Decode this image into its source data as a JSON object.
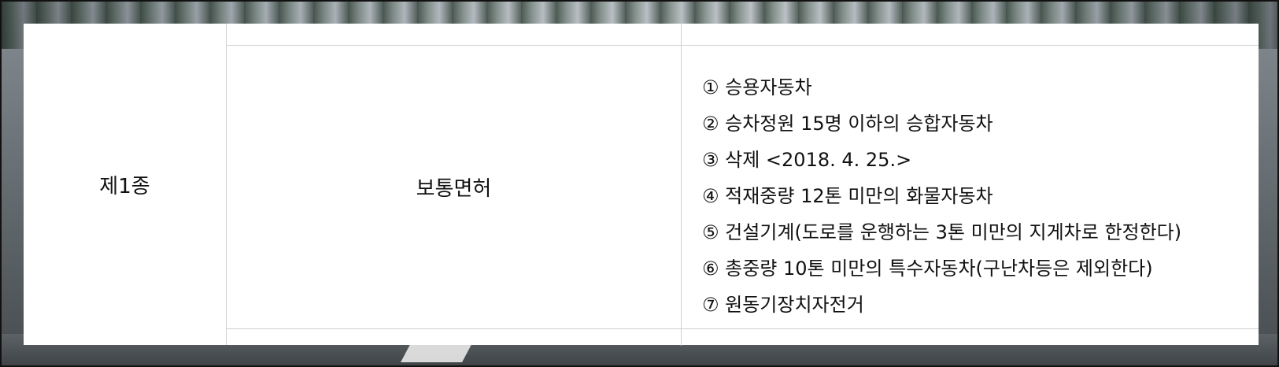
{
  "table": {
    "license_type": "제1종",
    "license_name": "보통면허",
    "vehicles": [
      "① 승용자동차",
      "② 승차정원 15명 이하의 승합자동차",
      "③ 삭제 <2018. 4. 25.>",
      "④ 적재중량 12톤 미만의 화물자동차",
      "⑤ 건설기계(도로를 운행하는 3톤 미만의 지게차로 한정한다)",
      "⑥ 총중량 10톤 미만의 특수자동차(구난차등은 제외한다)",
      "⑦ 원동기장치자전거"
    ]
  }
}
